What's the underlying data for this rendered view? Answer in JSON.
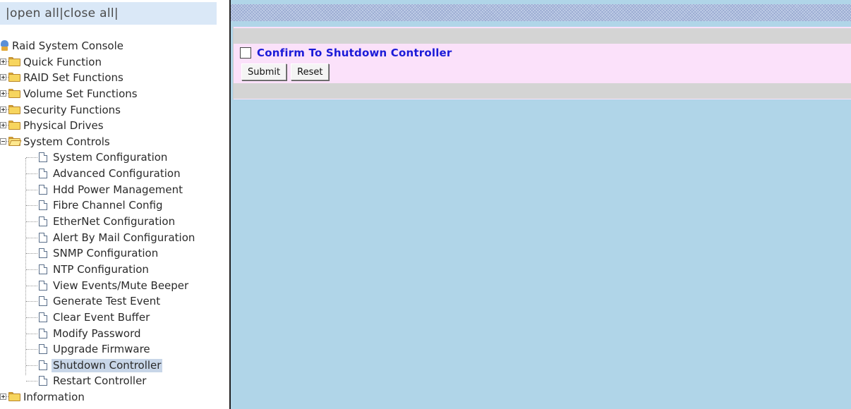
{
  "header": {
    "open_all": "|open all",
    "close_all": "|close all|"
  },
  "tree": {
    "root": "Raid System Console",
    "folders": {
      "quick": "Quick Function",
      "raid": "RAID Set Functions",
      "volume": "Volume Set Functions",
      "security": "Security Functions",
      "physical": "Physical Drives",
      "system": "System Controls",
      "information": "Information"
    },
    "system_items": [
      "System Configuration",
      "Advanced Configuration",
      "Hdd Power Management",
      "Fibre Channel Config",
      "EtherNet Configuration",
      "Alert By Mail Configuration",
      "SNMP Configuration",
      "NTP Configuration",
      "View Events/Mute Beeper",
      "Generate Test Event",
      "Clear Event Buffer",
      "Modify Password",
      "Upgrade Firmware",
      "Shutdown Controller",
      "Restart Controller"
    ],
    "selected": "Shutdown Controller"
  },
  "form": {
    "confirm_label": "Confirm To Shutdown Controller",
    "confirm_checked": false,
    "submit_label": "Submit",
    "reset_label": "Reset"
  },
  "colors": {
    "confirm_text": "#1b1bd8",
    "form_background": "#fbe1fa",
    "content_background": "#b0d5e8",
    "selected_item": "#c8d6e8"
  }
}
